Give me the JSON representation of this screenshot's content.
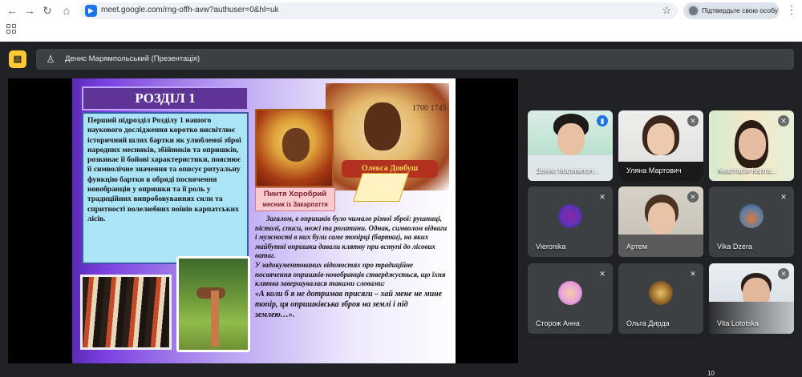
{
  "browser": {
    "url": "meet.google.com/rng-offh-avw?authuser=0&hl=uk",
    "profile_chip": "Підтвердьте свою особу"
  },
  "meet": {
    "presenter_label": "Денис Марямпольський (Презентація)",
    "participants": [
      {
        "name": "Денис Марямпол...",
        "mic": "speaking",
        "active": true
      },
      {
        "name": "Уляна Мартович",
        "mic": "muted"
      },
      {
        "name": "Анастасія Карта...",
        "mic": "muted"
      },
      {
        "name": "Vieronika",
        "mic": "muted"
      },
      {
        "name": "Артем",
        "mic": "muted"
      },
      {
        "name": "Vika Dzera",
        "mic": "muted"
      },
      {
        "name": "Сторож Анна",
        "mic": "muted"
      },
      {
        "name": "Ольга Дирда",
        "mic": "muted"
      },
      {
        "name": "Vita Lototska",
        "mic": "muted"
      }
    ],
    "bottom_count": "10"
  },
  "slide": {
    "title": "РОЗДІЛ 1",
    "box_text": "Перший підрозділ Розділу 1 нашого наукового дослідження коротко висвітлює історичний шлях бартки як улюбленої зброї народних месників, збійників та опришків, розкиває її бойові характеристики, пояснює її символічне значення та описує ритуальну функцію бартки в обряді посвячення новобранців у опришки та її роль у традиційних випробовуваннях сили та спритності волелюбних воїнів карпатських лісів.",
    "picture_label": "Пинтя Хоробрий",
    "picture_sublabel": "месник із Закарпаття",
    "picture_years": "1700 1745",
    "picture_caption": "Олекса Довбуш",
    "para1": "Загалом, в опришків було чимало різної зброї: рушниці, пістолі, списи, ножі та рогатини. Однак, символом відваги і мужності в них були саме топірці (бартки), на яких майбутні опришки давали клятву при вступі до лісових ватаг.",
    "para2": "У задокументованих відомостях про традиційне посвячення опришків-новобранців стверджується, що їхня клятва завершувалася такими словами:",
    "quote": "«А коли б я не дотримав присяги – хай мене не мине топір, ця опришківська зброя на землі і під землею…»."
  }
}
